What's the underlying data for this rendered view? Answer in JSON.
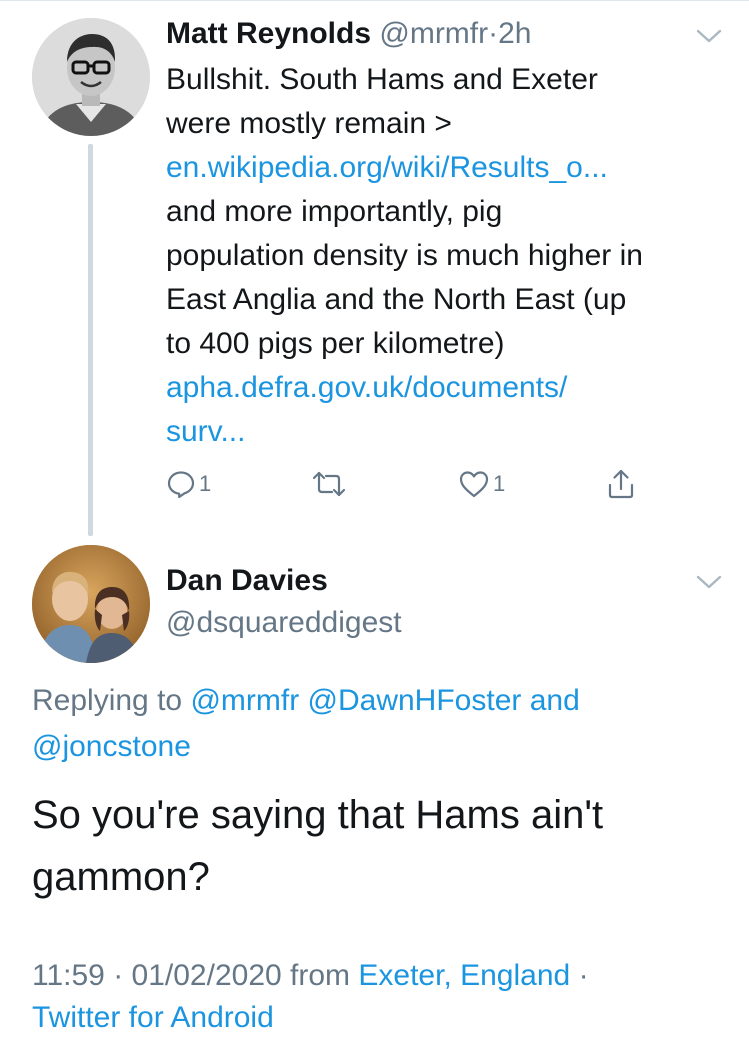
{
  "tweet1": {
    "author_name": "Matt Reynolds",
    "author_handle": "@mrmfr",
    "separator": "·",
    "time": "2h",
    "text_line1": "Bullshit. South Hams and Exeter",
    "text_line2": "were mostly remain >",
    "link1": "en.wikipedia.org/wiki/Results_o...",
    "text_line3": "and more importantly, pig",
    "text_line4": "population density is much higher in",
    "text_line5": "East Anglia and the North East (up",
    "text_line6": "to 400 pigs per kilometre)",
    "link2_line1": "apha.defra.gov.uk/documents/",
    "link2_line2": "surv...",
    "reply_count": "1",
    "like_count": "1",
    "icons": {
      "reply": "reply-icon",
      "retweet": "retweet-icon",
      "like": "heart-icon",
      "share": "share-icon",
      "menu": "chevron-down-icon"
    }
  },
  "tweet2": {
    "author_name": "Dan Davies",
    "author_handle": "@dsquareddigest",
    "replying_prefix": "Replying to",
    "replying_to_1": "@mrmfr",
    "replying_to_2": "@DawnHFoster",
    "replying_and": "and",
    "replying_to_3": "@joncstone",
    "text_line1": "So you're saying that Hams ain't",
    "text_line2": "gammon?",
    "time": "11:59",
    "sep1": "·",
    "date": "01/02/2020",
    "from_label": "from",
    "location": "Exeter, England",
    "sep2": "·",
    "source_cut": "Twitter for Android"
  },
  "colors": {
    "text": "#14171a",
    "secondary": "#657786",
    "link": "#1b95e0",
    "thread_line": "#cfd9de"
  }
}
